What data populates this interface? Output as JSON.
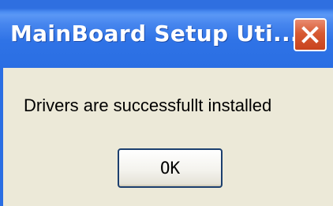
{
  "window": {
    "title": "MainBoard Setup Uti...",
    "close_icon": "close-icon"
  },
  "message": {
    "text": "Drivers are successfullt installed"
  },
  "buttons": {
    "ok_label": "OK"
  },
  "colors": {
    "titlebar": "#2a6ee3",
    "close_button": "#d75a33",
    "body_background": "#ece9d8"
  }
}
